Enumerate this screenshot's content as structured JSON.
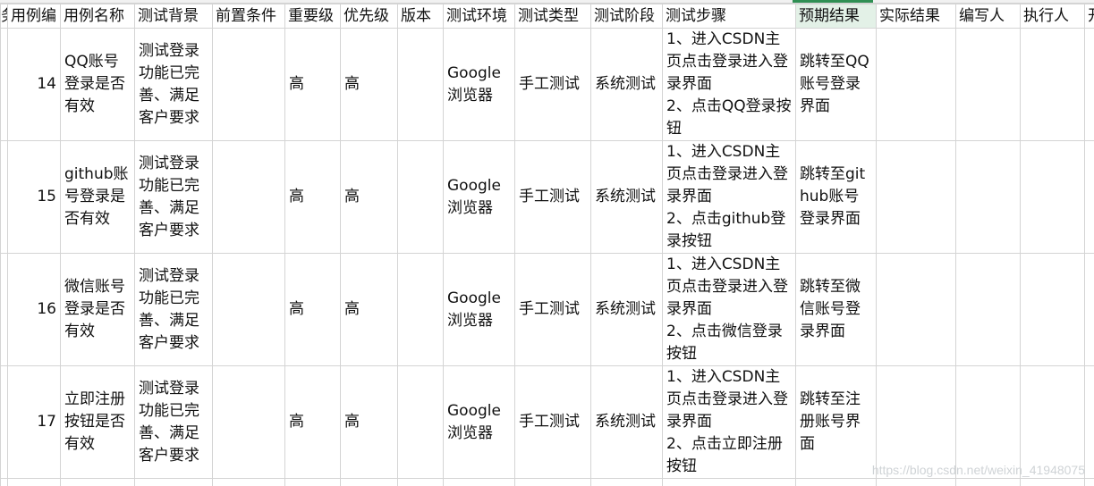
{
  "headers": [
    "务",
    "用例编",
    "用例名称",
    "测试背景",
    "前置条件",
    "重要级",
    "优先级",
    "版本",
    "测试环境",
    "测试类型",
    "测试阶段",
    "测试步骤",
    "预期结果",
    "实际结果",
    "编写人",
    "执行人",
    "开"
  ],
  "rows": [
    {
      "id": "14",
      "name": "QQ账号登录是否有效",
      "background": "测试登录功能已完善、满足客户要求",
      "precondition": "",
      "importance": "高",
      "priority": "高",
      "version": "",
      "environment": "Google浏览器",
      "type": "手工测试",
      "stage": "系统测试",
      "steps": [
        "1、进入CSDN主页点击登录进入登录界面",
        "2、点击QQ登录按钮"
      ],
      "expected": "跳转至QQ账号登录界面",
      "actual": "",
      "writer": "",
      "executor": ""
    },
    {
      "id": "15",
      "name": "github账号登录是否有效",
      "background": "测试登录功能已完善、满足客户要求",
      "precondition": "",
      "importance": "高",
      "priority": "高",
      "version": "",
      "environment": "Google浏览器",
      "type": "手工测试",
      "stage": "系统测试",
      "steps": [
        "1、进入CSDN主页点击登录进入登录界面",
        "2、点击github登录按钮"
      ],
      "expected": "跳转至github账号登录界面",
      "actual": "",
      "writer": "",
      "executor": ""
    },
    {
      "id": "16",
      "name": "微信账号登录是否有效",
      "background": "测试登录功能已完善、满足客户要求",
      "precondition": "",
      "importance": "高",
      "priority": "高",
      "version": "",
      "environment": "Google浏览器",
      "type": "手工测试",
      "stage": "系统测试",
      "steps": [
        "1、进入CSDN主页点击登录进入登录界面",
        "2、点击微信登录按钮"
      ],
      "expected": "跳转至微信账号登录界面",
      "actual": "",
      "writer": "",
      "executor": ""
    },
    {
      "id": "17",
      "name": "立即注册按钮是否有效",
      "background": "测试登录功能已完善、满足客户要求",
      "precondition": "",
      "importance": "高",
      "priority": "高",
      "version": "",
      "environment": "Google浏览器",
      "type": "手工测试",
      "stage": "系统测试",
      "steps": [
        "1、进入CSDN主页点击登录进入登录界面",
        "2、点击立即注册按钮"
      ],
      "expected": "跳转至注册账号界面",
      "actual": "",
      "writer": "",
      "executor": ""
    }
  ],
  "watermark": "https://blog.csdn.net/weixin_41948075",
  "colors": {
    "gridline": "#d4d4d4",
    "selected_header_bg": "#e3f1e7",
    "selected_header_accent": "#2f8f53"
  }
}
